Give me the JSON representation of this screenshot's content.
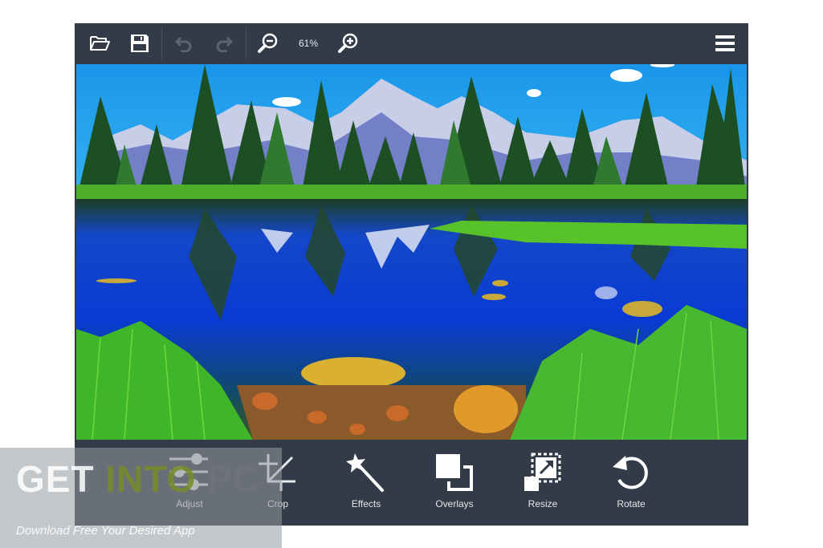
{
  "toolbar": {
    "open_icon": "folder-open-icon",
    "save_icon": "floppy-disk-icon",
    "undo_icon": "undo-icon",
    "redo_icon": "redo-icon",
    "zoom_out_icon": "zoom-out-icon",
    "zoom_level": "61%",
    "zoom_in_icon": "zoom-in-icon",
    "menu_icon": "hamburger-menu-icon"
  },
  "canvas": {
    "image_description": "Mountain lake landscape with pine trees, snowy peaks, blue sky and grass",
    "colors": {
      "sky": "#1fa0ec",
      "water": "#0a3fd6",
      "grass": "#3fb81f",
      "trees": "#1c4a22"
    }
  },
  "tools": [
    {
      "label": "Adjust",
      "icon": "sliders-icon"
    },
    {
      "label": "Crop",
      "icon": "crop-icon"
    },
    {
      "label": "Effects",
      "icon": "magic-wand-icon"
    },
    {
      "label": "Overlays",
      "icon": "overlays-icon"
    },
    {
      "label": "Resize",
      "icon": "resize-icon"
    },
    {
      "label": "Rotate",
      "icon": "rotate-icon"
    }
  ],
  "watermark": {
    "title_get": "GET ",
    "title_into": "INTO",
    "title_pc": " PC",
    "subtitle": "Download Free Your Desired App"
  },
  "theme": {
    "bar_bg": "#333a48",
    "icon_color": "#ffffff",
    "disabled_icon": "#5c6474"
  }
}
